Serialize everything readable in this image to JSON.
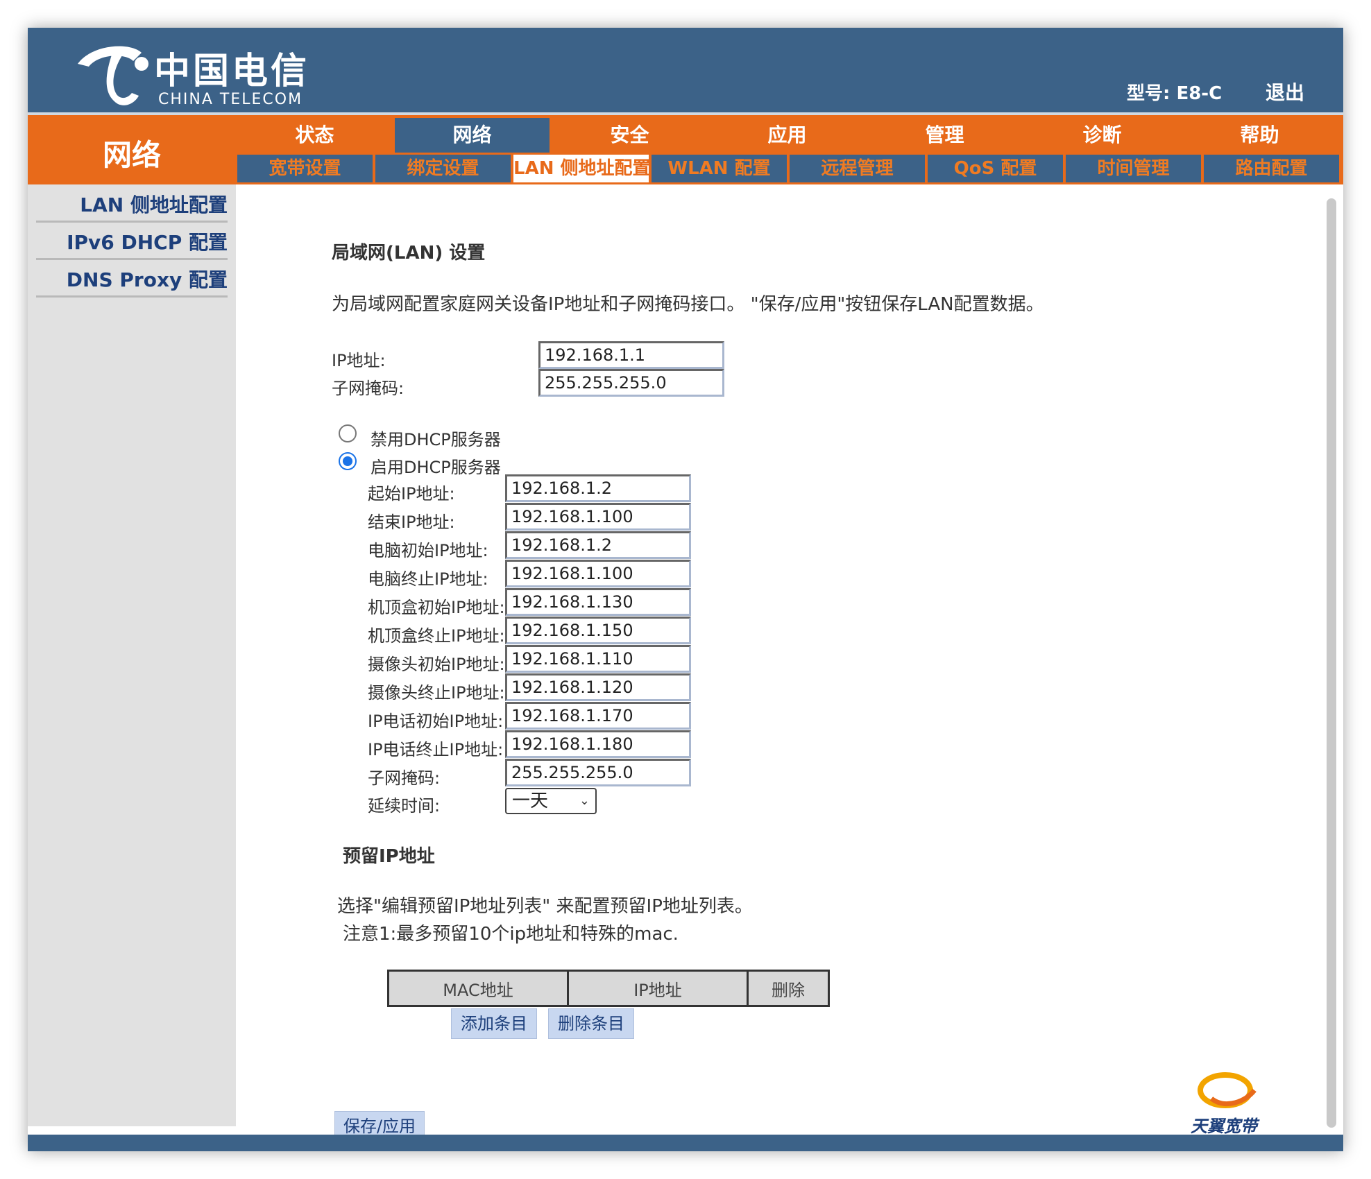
{
  "header": {
    "brand_cn": "中国电信",
    "brand_en": "CHINA TELECOM",
    "model": "型号: E8-C",
    "logout": "退出"
  },
  "section_title": "网络",
  "nav_main": [
    {
      "label": "状态",
      "active": false
    },
    {
      "label": "网络",
      "active": true
    },
    {
      "label": "安全",
      "active": false
    },
    {
      "label": "应用",
      "active": false
    },
    {
      "label": "管理",
      "active": false
    },
    {
      "label": "诊断",
      "active": false
    },
    {
      "label": "帮助",
      "active": false
    }
  ],
  "nav_sub": [
    {
      "label": "宽带设置",
      "active": false
    },
    {
      "label": "绑定设置",
      "active": false
    },
    {
      "label": "LAN 侧地址配置",
      "active": true
    },
    {
      "label": "WLAN 配置",
      "active": false
    },
    {
      "label": "远程管理",
      "active": false
    },
    {
      "label": "QoS 配置",
      "active": false
    },
    {
      "label": "时间管理",
      "active": false
    },
    {
      "label": "路由配置",
      "active": false
    }
  ],
  "sidebar": [
    {
      "label": "LAN 侧地址配置"
    },
    {
      "label": "IPv6 DHCP 配置"
    },
    {
      "label": "DNS Proxy 配置"
    }
  ],
  "main": {
    "title": "局域网(LAN) 设置",
    "description": "为局域网配置家庭网关设备IP地址和子网掩码接口。 \"保存/应用\"按钮保存LAN配置数据。",
    "ip_label": "IP地址:",
    "ip_value": "192.168.1.1",
    "mask_label": "子网掩码:",
    "mask_value": "255.255.255.0",
    "dhcp_disable_label": "禁用DHCP服务器",
    "dhcp_enable_label": "启用DHCP服务器",
    "dhcp_selected": "enable",
    "dhcp_fields": [
      {
        "label": "起始IP地址:",
        "value": "192.168.1.2"
      },
      {
        "label": "结束IP地址:",
        "value": "192.168.1.100"
      },
      {
        "label": "电脑初始IP地址:",
        "value": "192.168.1.2"
      },
      {
        "label": "电脑终止IP地址:",
        "value": "192.168.1.100"
      },
      {
        "label": "机顶盒初始IP地址:",
        "value": "192.168.1.130"
      },
      {
        "label": "机顶盒终止IP地址:",
        "value": "192.168.1.150"
      },
      {
        "label": "摄像头初始IP地址:",
        "value": "192.168.1.110"
      },
      {
        "label": "摄像头终止IP地址:",
        "value": "192.168.1.120"
      },
      {
        "label": "IP电话初始IP地址:",
        "value": "192.168.1.170"
      },
      {
        "label": "IP电话终止IP地址:",
        "value": "192.168.1.180"
      },
      {
        "label": "子网掩码:",
        "value": "255.255.255.0"
      }
    ],
    "lease_label": "延续时间:",
    "lease_value": "一天",
    "reserved_title": "预留IP地址",
    "reserved_desc1": "选择\"编辑预留IP地址列表\" 来配置预留IP地址列表。",
    "reserved_desc2": "注意1:最多预留10个ip地址和特殊的mac.",
    "table_headers": [
      "MAC地址",
      "IP地址",
      "删除"
    ],
    "add_button": "添加条目",
    "delete_button": "删除条目",
    "save_button": "保存/应用"
  },
  "footer_logo_text": "天翼宽带",
  "colors": {
    "header_blue": "#3c6288",
    "orange": "#e86a1a",
    "sidebar_gray": "#e1e1e1",
    "link_blue": "#1d3f7b"
  }
}
